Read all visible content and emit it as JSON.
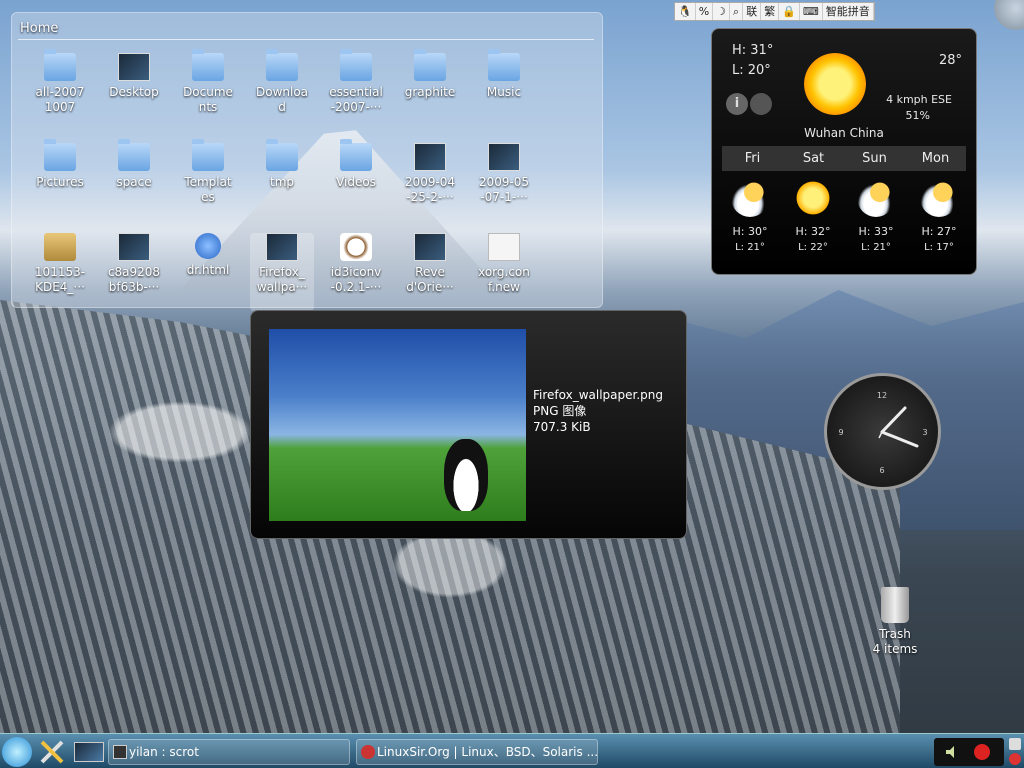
{
  "folder_view": {
    "title": "Home",
    "items": [
      {
        "label": "all-2007\n1007",
        "icon": "folder-icon"
      },
      {
        "label": "Desktop",
        "icon": "desktop-icon"
      },
      {
        "label": "Docume\nnts",
        "icon": "folder-icon"
      },
      {
        "label": "Downloa\nd",
        "icon": "folder-icon"
      },
      {
        "label": "essential\n-2007-···",
        "icon": "folder-icon"
      },
      {
        "label": "graphite",
        "icon": "folder-icon"
      },
      {
        "label": "Music",
        "icon": "folder-icon"
      },
      {
        "label": "Pictures",
        "icon": "folder-icon"
      },
      {
        "label": "space",
        "icon": "folder-icon"
      },
      {
        "label": "Templat\nes",
        "icon": "folder-icon"
      },
      {
        "label": "tmp",
        "icon": "folder-icon"
      },
      {
        "label": "Videos",
        "icon": "folder-icon"
      },
      {
        "label": "2009-04\n-25-2-···",
        "icon": "screenshot-icon"
      },
      {
        "label": "2009-05\n-07-1-···",
        "icon": "screenshot-icon"
      },
      {
        "label": "101153-\nKDE4_···",
        "icon": "package-icon"
      },
      {
        "label": "c8a9208\nbf63b-···",
        "icon": "image-icon"
      },
      {
        "label": "dr.html",
        "icon": "html-icon"
      },
      {
        "label": "Firefox_\nwallpa···",
        "icon": "image-icon"
      },
      {
        "label": "id3iconv\n-0.2.1-···",
        "icon": "coffee-icon"
      },
      {
        "label": "Reve\nd'Orie···",
        "icon": "image-icon"
      },
      {
        "label": "xorg.con\nf.new",
        "icon": "text-file-icon"
      }
    ]
  },
  "preview": {
    "filename": "Firefox_wallpaper.png",
    "type": "PNG 图像",
    "size": "707.3 KiB"
  },
  "weather": {
    "high": "H: 31°",
    "low": "L: 20°",
    "current": "28°",
    "wind": "4  kmph  ESE",
    "humidity": "51%",
    "city": "Wuhan China",
    "info_button": "i",
    "days": [
      "Fri",
      "Sat",
      "Sun",
      "Mon"
    ],
    "forecast": [
      {
        "icon": "partly-cloudy-icon",
        "high": "H: 30°",
        "low": "L: 21°"
      },
      {
        "icon": "sun-icon",
        "high": "H: 32°",
        "low": "L: 22°"
      },
      {
        "icon": "partly-cloudy-icon",
        "high": "H: 33°",
        "low": "L: 21°"
      },
      {
        "icon": "partly-cloudy-icon",
        "high": "H: 27°",
        "low": "L: 17°"
      }
    ]
  },
  "clock": {
    "numbers": [
      "12",
      "3",
      "6",
      "9"
    ]
  },
  "trash": {
    "label": "Trash",
    "count": "4 items"
  },
  "ime_bar": {
    "items": [
      "🐧",
      "%",
      "☽",
      "⌕",
      "联",
      "繁",
      "🔒",
      "⌨",
      "智能拼音"
    ]
  },
  "taskbar": {
    "tasks": [
      {
        "label": "yilan : scrot"
      },
      {
        "label": "LinuxSir.Org | Linux、BSD、Solaris ..."
      }
    ]
  },
  "colors": {
    "panel": "#1f4a66",
    "sun": "#ffc200"
  }
}
